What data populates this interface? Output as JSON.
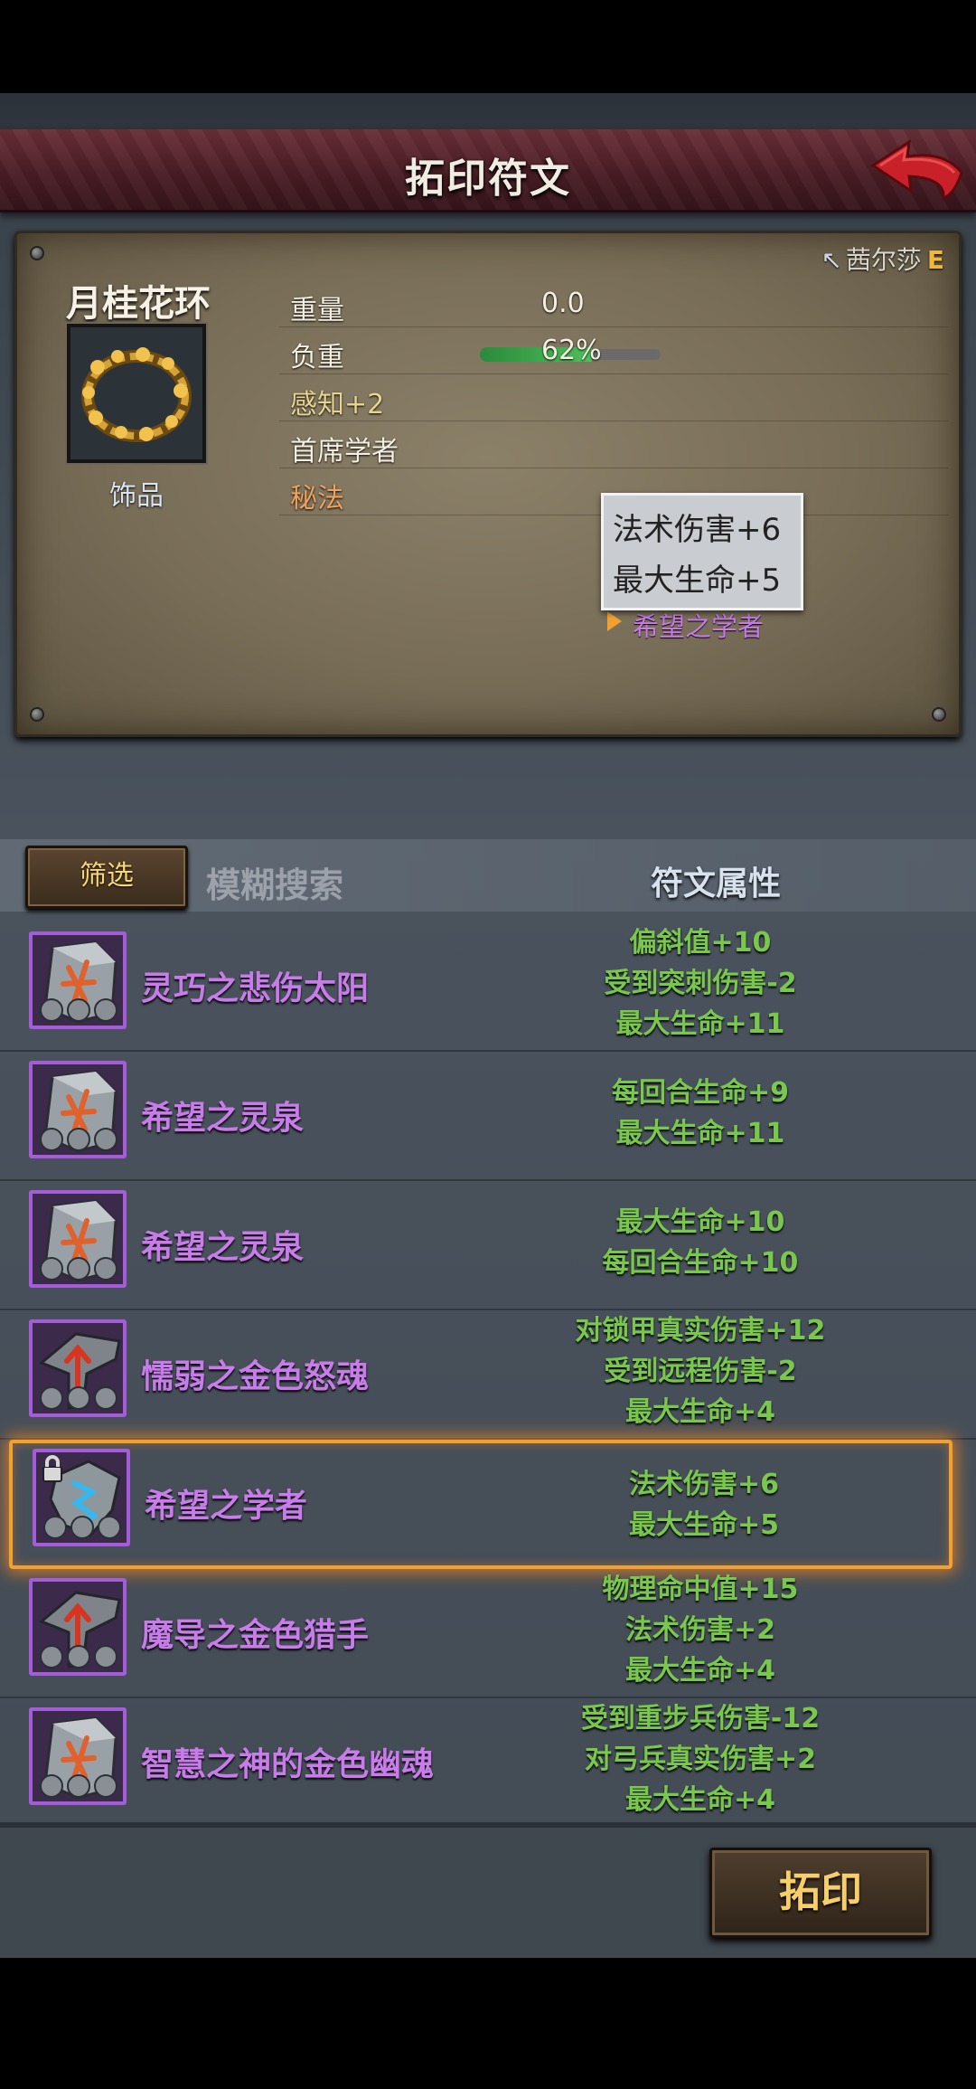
{
  "title": "拓印符文",
  "item": {
    "name": "月桂花环",
    "type": "饰品",
    "owner": "茜尔莎",
    "owner_rank": "E",
    "stats": {
      "weight_label": "重量",
      "weight_value": "0.0",
      "load_label": "负重",
      "load_value": "62%",
      "load_fraction": 0.62,
      "perception": "感知+2",
      "trait": "首席学者",
      "secret_label": "秘法",
      "secret_value": "希望之学者"
    },
    "tooltip": [
      "法术伤害+6",
      "最大生命+5"
    ]
  },
  "filter": {
    "button_label": "筛选",
    "search_placeholder": "模糊搜索",
    "attr_header": "符文属性"
  },
  "runes": [
    {
      "name": "灵巧之悲伤太阳",
      "attrs": [
        "偏斜值+10",
        "受到突刺伤害-2",
        "最大生命+11"
      ],
      "shape": "slab",
      "glyph_color": "#e0612b",
      "locked": false
    },
    {
      "name": "希望之灵泉",
      "attrs": [
        "每回合生命+9",
        "最大生命+11"
      ],
      "shape": "slab",
      "glyph_color": "#e0612b",
      "locked": false
    },
    {
      "name": "希望之灵泉",
      "attrs": [
        "最大生命+10",
        "每回合生命+10"
      ],
      "shape": "slab",
      "glyph_color": "#e0612b",
      "locked": false
    },
    {
      "name": "懦弱之金色怒魂",
      "attrs": [
        "对锁甲真实伤害+12",
        "受到远程伤害-2",
        "最大生命+4"
      ],
      "shape": "arrow",
      "glyph_color": "#d8341f",
      "locked": false
    },
    {
      "name": "希望之学者",
      "attrs": [
        "法术伤害+6",
        "最大生命+5"
      ],
      "shape": "crystal",
      "glyph_color": "#35b8f0",
      "locked": true
    },
    {
      "name": "魔导之金色猎手",
      "attrs": [
        "物理命中值+15",
        "法术伤害+2",
        "最大生命+4"
      ],
      "shape": "arrow",
      "glyph_color": "#d8341f",
      "locked": false
    },
    {
      "name": "智慧之神的金色幽魂",
      "attrs": [
        "受到重步兵伤害-12",
        "对弓兵真实伤害+2",
        "最大生命+4"
      ],
      "shape": "slab",
      "glyph_color": "#e0612b",
      "locked": false
    }
  ],
  "selected_index": 4,
  "imprint_button": "拓印",
  "colors": {
    "rune_name": "#c77ce9",
    "attr_green": "#79c84d",
    "highlight": "#f0a132",
    "title_bar": "#4a1d25"
  },
  "icons": {
    "back": "red-back-arrow-icon",
    "lock": "lock-icon"
  }
}
